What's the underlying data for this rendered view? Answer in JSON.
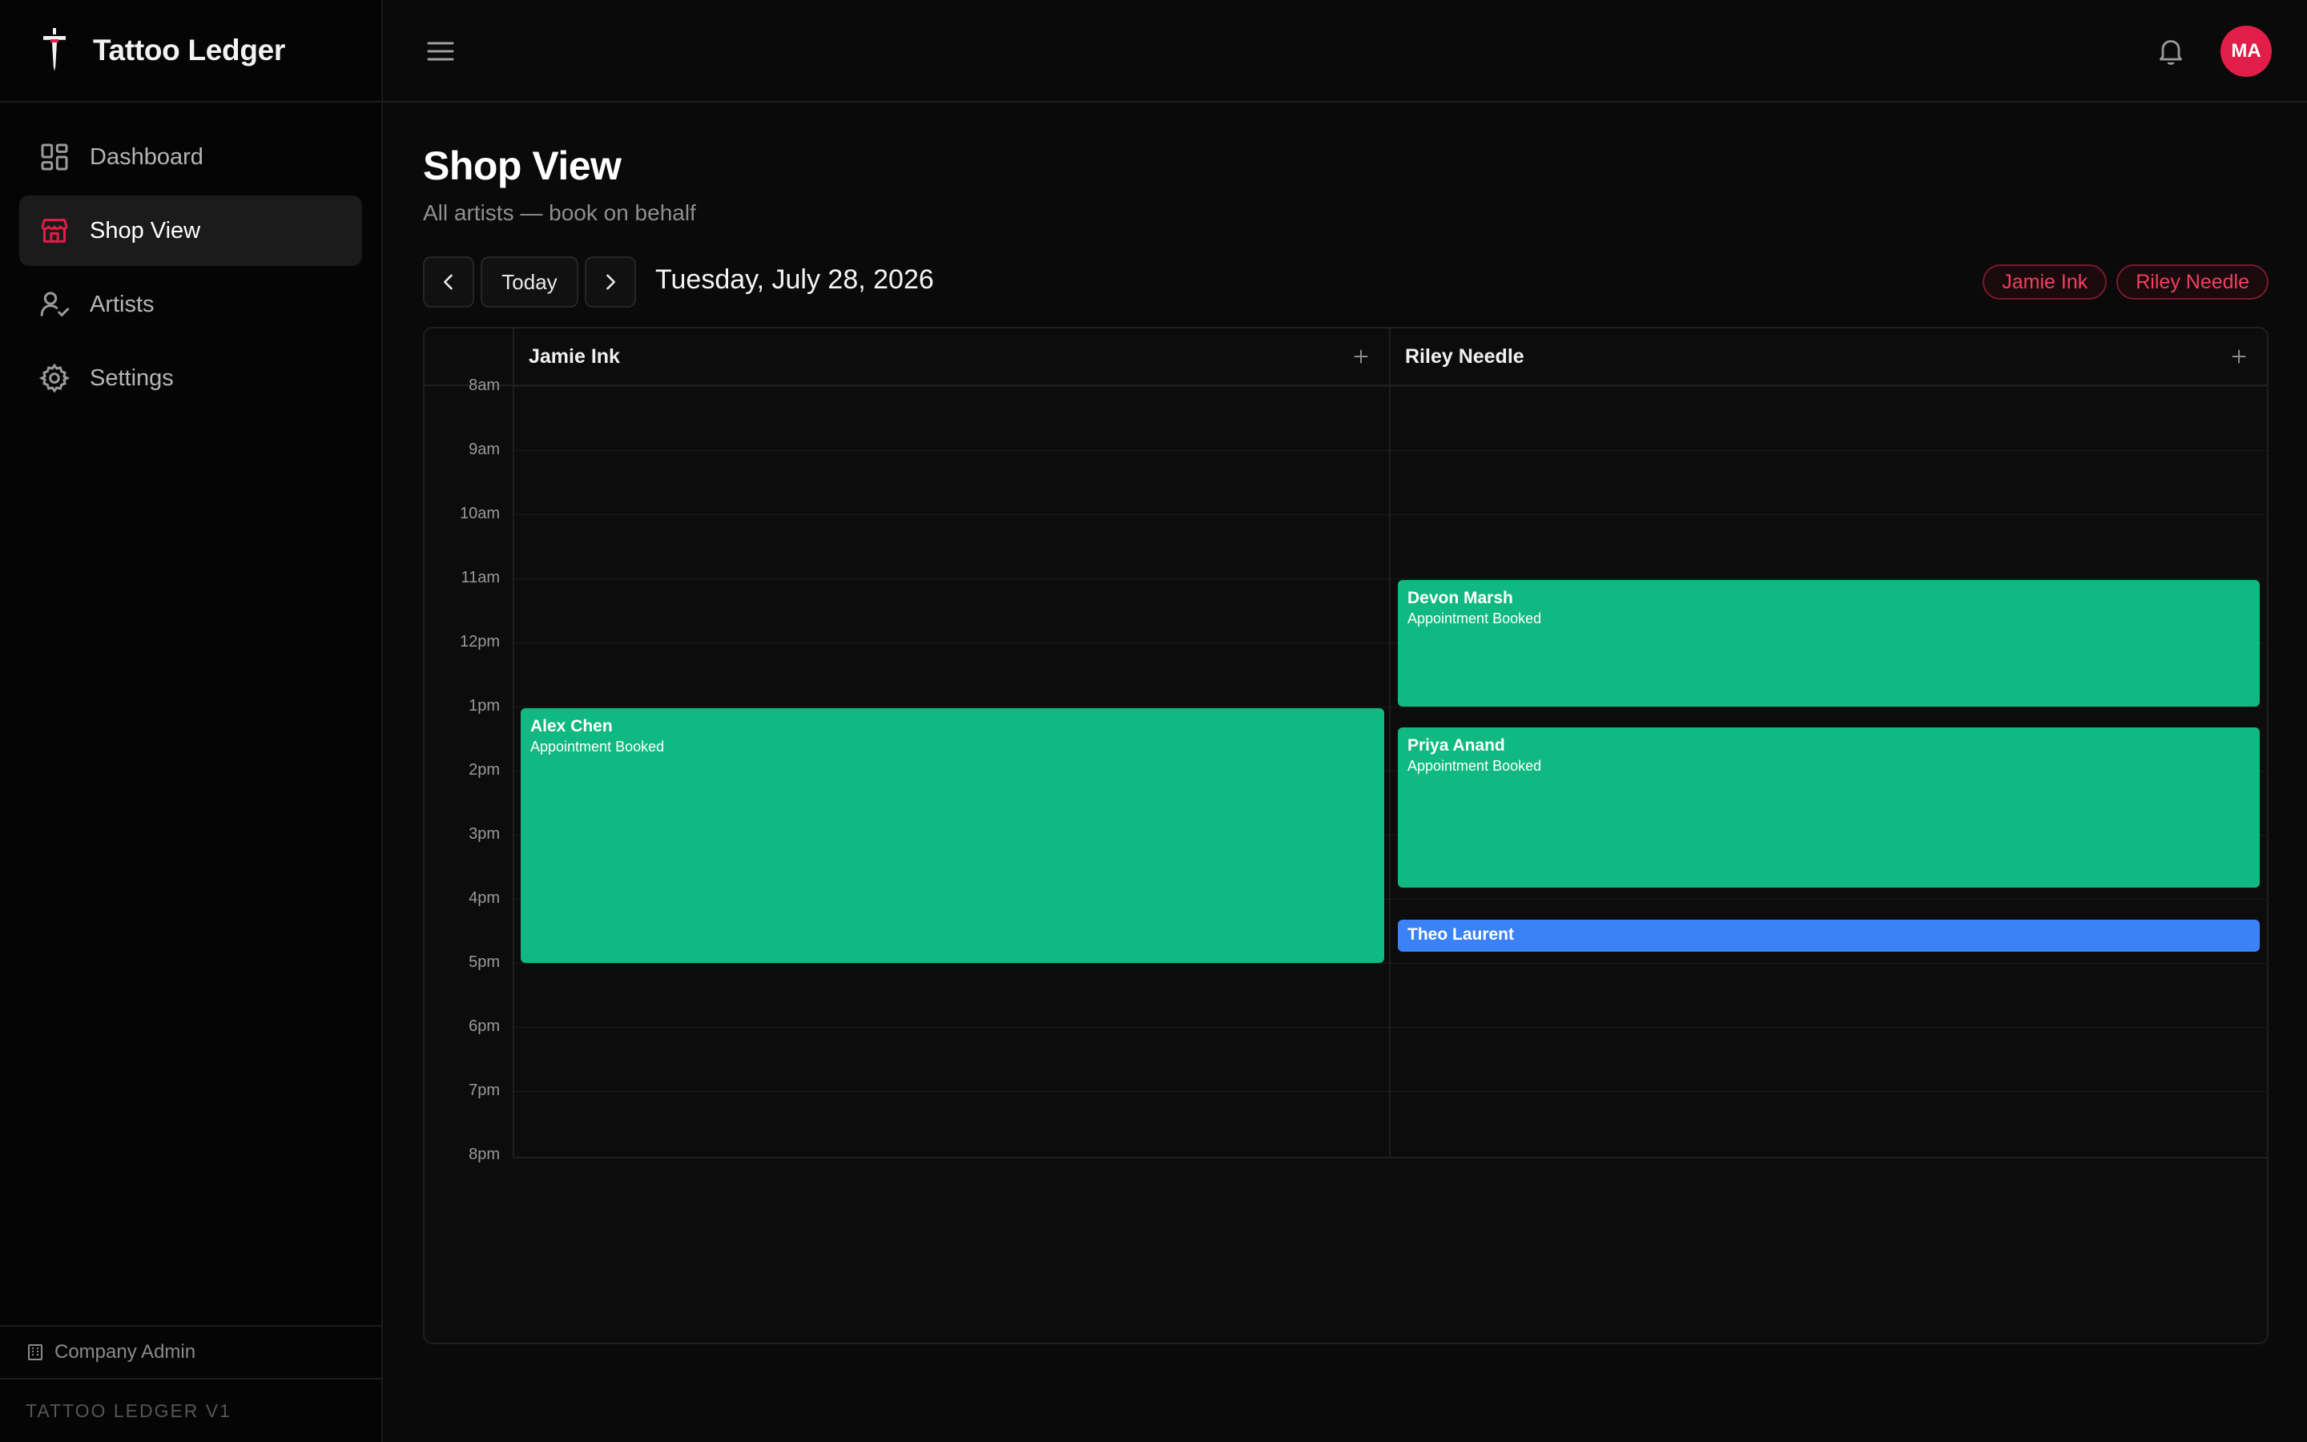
{
  "app": {
    "name": "Tattoo Ledger",
    "version_label": "TATTOO LEDGER V1",
    "role_label": "Company Admin"
  },
  "sidebar": {
    "items": [
      {
        "label": "Dashboard",
        "icon": "dashboard-icon",
        "active": false
      },
      {
        "label": "Shop View",
        "icon": "store-icon",
        "active": true
      },
      {
        "label": "Artists",
        "icon": "user-check-icon",
        "active": false
      },
      {
        "label": "Settings",
        "icon": "gear-icon",
        "active": false
      }
    ]
  },
  "topbar": {
    "avatar_initials": "MA"
  },
  "page": {
    "title": "Shop View",
    "subtitle": "All artists — book on behalf"
  },
  "toolbar": {
    "today_label": "Today",
    "date": "Tuesday, July 28, 2026",
    "filter_chips": [
      "Jamie Ink",
      "Riley Needle"
    ]
  },
  "calendar": {
    "columns": [
      "Jamie Ink",
      "Riley Needle"
    ],
    "times": [
      "8am",
      "9am",
      "10am",
      "11am",
      "12pm",
      "1pm",
      "2pm",
      "3pm",
      "4pm",
      "5pm",
      "6pm",
      "7pm",
      "8pm"
    ],
    "events": [
      {
        "artist": "Jamie Ink",
        "client": "Alex Chen",
        "status": "Appointment Booked"
      },
      {
        "artist": "Riley Needle",
        "client": "Devon Marsh",
        "status": "Appointment Booked"
      },
      {
        "artist": "Riley Needle",
        "client": "Priya Anand",
        "status": "Appointment Booked"
      },
      {
        "artist": "Riley Needle",
        "client": "Theo Laurent",
        "status": ""
      }
    ]
  },
  "colors": {
    "accent": "#e11d48",
    "chip_text": "#f43f5e",
    "event_booked": "#10b981",
    "event_other": "#3b82f6",
    "background": "#0a0a0a"
  }
}
